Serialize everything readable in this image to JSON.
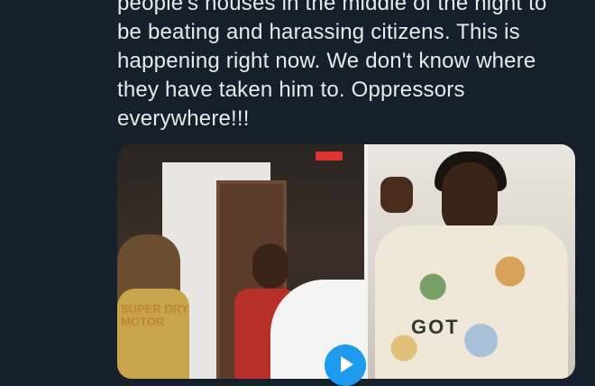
{
  "tweet": {
    "lines": [
      "people's houses in the middle of the night to",
      "be beating and harassing citizens. This is",
      "happening right now. We don't know where",
      "they have taken him to. Oppressors",
      "everywhere!!!"
    ]
  },
  "media": {
    "left_shirt_print": "SUPER DRY MOTOR",
    "right_sweater_print": "GOT"
  },
  "colors": {
    "background": "#15202b",
    "text": "#e7e9ea",
    "accent": "#1d9bf0"
  }
}
